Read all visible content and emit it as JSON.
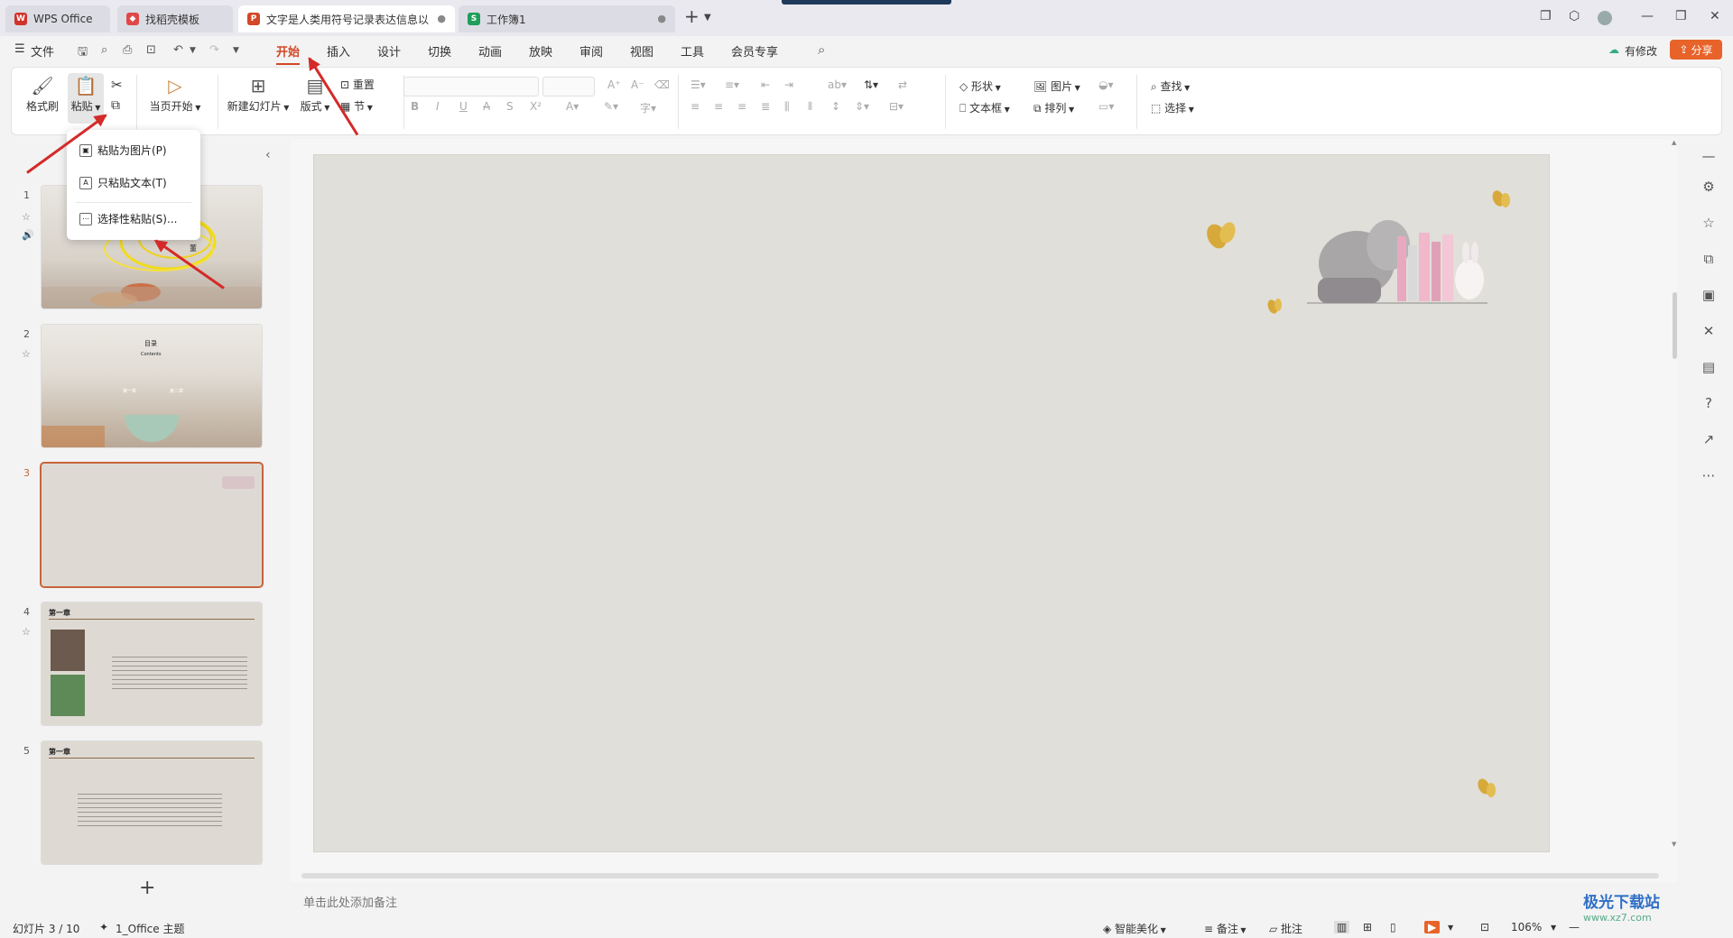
{
  "titlebar": {
    "tabs": [
      {
        "label": "WPS Office",
        "icon": "wps-logo-icon",
        "color": "#d0342c"
      },
      {
        "label": "找稻壳模板",
        "icon": "docer-icon",
        "color": "#e04848"
      },
      {
        "label": "文字是人类用符号记录表达信息以",
        "icon": "ppt-icon",
        "color": "#d24726"
      },
      {
        "label": "工作簿1",
        "icon": "sheet-icon",
        "color": "#1e9e5a"
      }
    ],
    "new_tab": "+"
  },
  "menu": {
    "file": "文件",
    "tabs": [
      "开始",
      "插入",
      "设计",
      "切换",
      "动画",
      "放映",
      "审阅",
      "视图",
      "工具",
      "会员专享"
    ],
    "active_tab": "开始",
    "modified": "有修改",
    "share": "分享",
    "accent": "#d24726",
    "share_color": "#e8632a"
  },
  "ribbon": {
    "format_painter": "格式刷",
    "paste": "粘贴",
    "start_from_current": "当页开始",
    "new_slide": "新建幻灯片",
    "layout": "版式",
    "reset": "重置",
    "section": "节",
    "shape": "形状",
    "picture": "图片",
    "textbox": "文本框",
    "arrange": "排列",
    "find": "查找",
    "select": "选择"
  },
  "paste_menu": {
    "items": [
      "粘贴为图片(P)",
      "只粘贴文本(T)",
      "选择性粘贴(S)..."
    ]
  },
  "slides": {
    "numbers": [
      "1",
      "2",
      "3",
      "4",
      "5"
    ],
    "selected": "3",
    "slide1_title": "董",
    "slide2_title": "目录",
    "slide2_subtitle": "Contents",
    "slide2_item1": "第一章",
    "slide2_item2": "第二章",
    "slide4_title": "第一章",
    "slide5_title": "第一章",
    "add": "+"
  },
  "notes_placeholder": "单击此处添加备注",
  "status": {
    "slide_counter": "幻灯片 3 / 10",
    "theme": "1_Office 主题",
    "beautify": "智能美化",
    "notes": "备注",
    "comments": "批注",
    "zoom": "106%"
  },
  "watermark": {
    "title": "极光下载站",
    "url": "www.xz7.com"
  }
}
